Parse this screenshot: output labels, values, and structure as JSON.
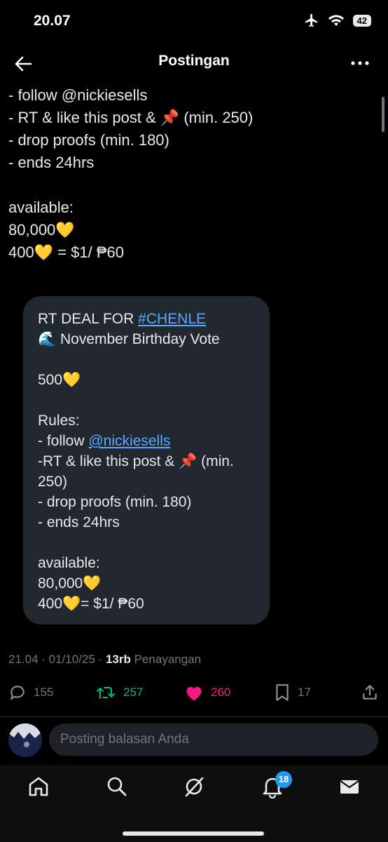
{
  "status_bar": {
    "time": "20.07",
    "battery": "42"
  },
  "header": {
    "title": "Postingan"
  },
  "post": {
    "lines": [
      "- follow @nickiesells",
      "- RT & like this post & 📌 (min. 250)",
      "- drop proofs (min. 180)",
      "- ends 24hrs",
      "",
      "available:",
      "80,000💛",
      "400💛 = $1/ ₱60"
    ]
  },
  "card": {
    "line1_prefix": "RT DEAL FOR ",
    "hashtag": "#CHENLE",
    "line2": "🌊 November Birthday Vote",
    "line3": "500💛",
    "rules_label": "Rules:",
    "rule1_prefix": "- follow ",
    "mention": "@nickiesells",
    "rule2a": "-RT & like this post & 📌 (min.",
    "rule2b": "250)",
    "rule3": "- drop proofs (min. 180)",
    "rule4": "- ends 24hrs",
    "available_label": "available:",
    "available_amount": "80,000💛",
    "rate": "400💛= $1/ ₱60"
  },
  "meta": {
    "time_date": "21.04 · 01/10/25 · ",
    "views_count": "13rb",
    "views_label": " Penayangan"
  },
  "actions": {
    "replies": "155",
    "reposts": "257",
    "likes": "260",
    "bookmarks": "17",
    "colors": {
      "repost": "#00ba7c",
      "like": "#f91880",
      "default": "#71767b"
    }
  },
  "reply": {
    "placeholder": "Posting balasan Anda"
  },
  "nav": {
    "notifications_badge": "18"
  },
  "icons": [
    "back-arrow-icon",
    "more-icon",
    "reply-icon",
    "repost-icon",
    "heart-icon",
    "bookmark-icon",
    "share-icon",
    "home-icon",
    "search-icon",
    "grok-icon",
    "bell-icon",
    "mail-icon"
  ]
}
